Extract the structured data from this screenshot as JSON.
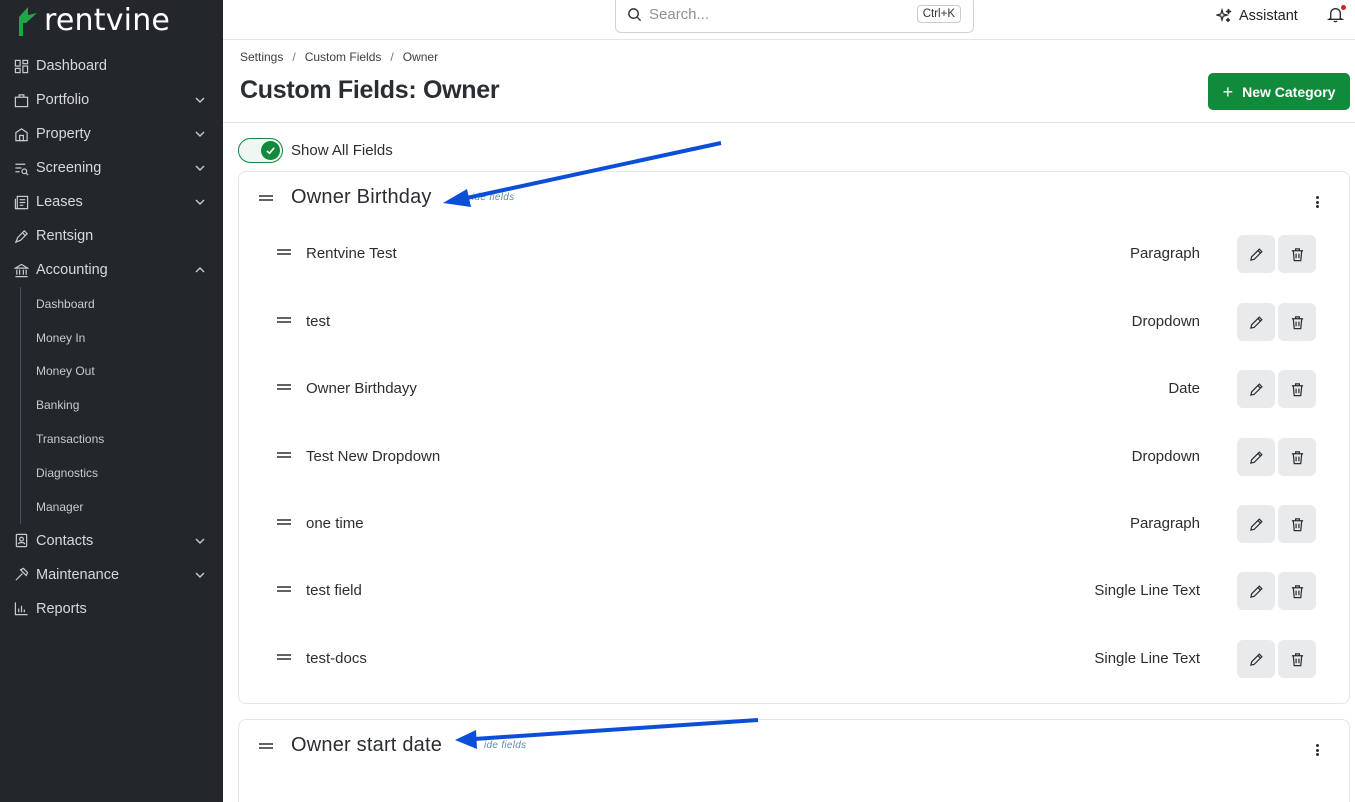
{
  "brand": {
    "name": "rentvine",
    "accent": "#118a3c"
  },
  "sidebar": {
    "items": [
      {
        "label": "Dashboard",
        "icon": "dashboard-icon",
        "chevron": false
      },
      {
        "label": "Portfolio",
        "icon": "portfolio-icon",
        "chevron": "down"
      },
      {
        "label": "Property",
        "icon": "property-icon",
        "chevron": "down"
      },
      {
        "label": "Screening",
        "icon": "screening-icon",
        "chevron": "down"
      },
      {
        "label": "Leases",
        "icon": "leases-icon",
        "chevron": "down"
      },
      {
        "label": "Rentsign",
        "icon": "rentsign-icon",
        "chevron": false
      },
      {
        "label": "Accounting",
        "icon": "accounting-icon",
        "chevron": "up"
      }
    ],
    "accounting_sub": [
      "Dashboard",
      "Money In",
      "Money Out",
      "Banking",
      "Transactions",
      "Diagnostics",
      "Manager"
    ],
    "items_after": [
      {
        "label": "Contacts",
        "icon": "contacts-icon",
        "chevron": "down"
      },
      {
        "label": "Maintenance",
        "icon": "maintenance-icon",
        "chevron": "down"
      },
      {
        "label": "Reports",
        "icon": "reports-icon",
        "chevron": false
      }
    ]
  },
  "topbar": {
    "search_placeholder": "Search...",
    "search_shortcut": "Ctrl+K",
    "assistant_label": "Assistant",
    "has_notification": true
  },
  "breadcrumb": [
    "Settings",
    "Custom Fields",
    "Owner"
  ],
  "page_title": "Custom Fields: Owner",
  "new_category_label": "New Category",
  "toggle": {
    "label": "Show All Fields",
    "on": true
  },
  "categories": [
    {
      "title": "Owner Birthday",
      "hint": "ide fields",
      "fields": [
        {
          "name": "Rentvine Test",
          "type": "Paragraph"
        },
        {
          "name": "test",
          "type": "Dropdown"
        },
        {
          "name": "Owner Birthdayy",
          "type": "Date"
        },
        {
          "name": "Test New Dropdown",
          "type": "Dropdown"
        },
        {
          "name": "one time",
          "type": "Paragraph"
        },
        {
          "name": "test field",
          "type": "Single Line Text"
        },
        {
          "name": "test-docs",
          "type": "Single Line Text"
        }
      ]
    },
    {
      "title": "Owner start date",
      "hint": "ide fields",
      "fields": []
    }
  ],
  "annotation_color": "#0b4fd9"
}
